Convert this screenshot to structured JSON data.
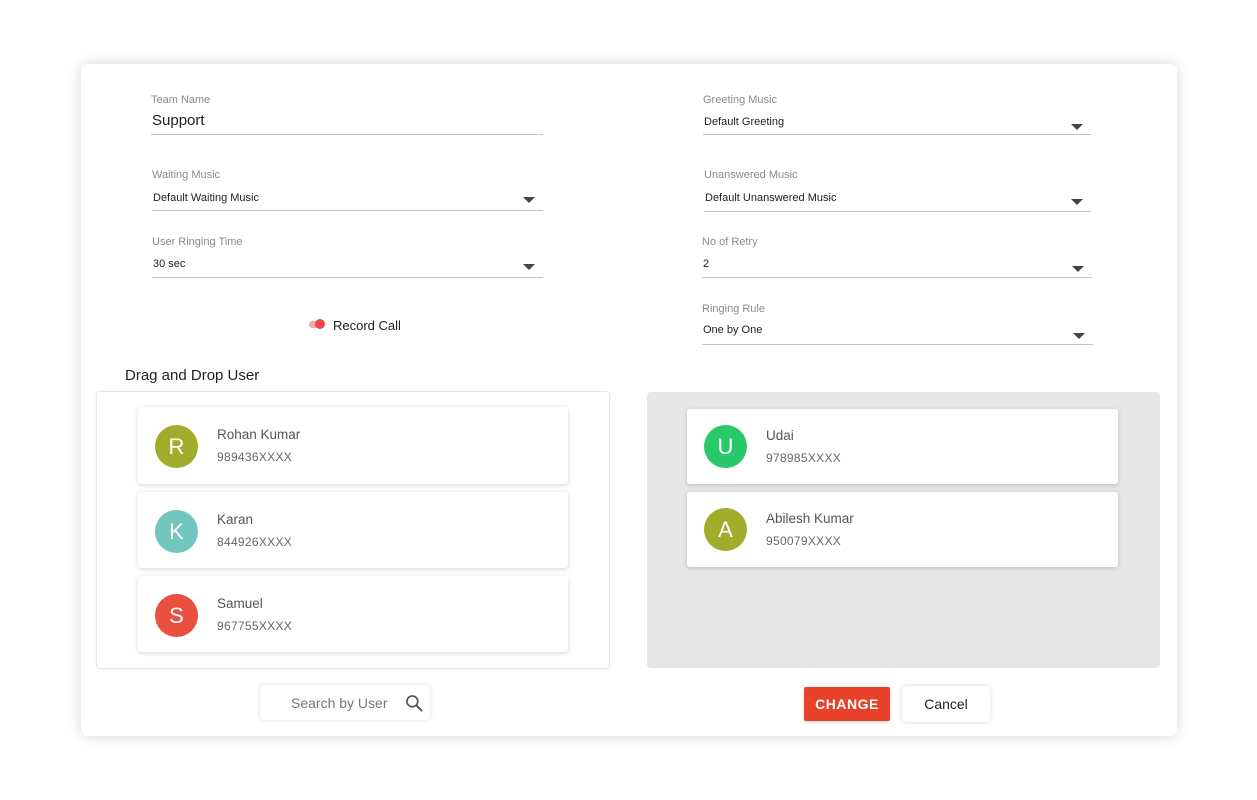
{
  "form": {
    "team_name": {
      "label": "Team Name",
      "value": "Support"
    },
    "greeting_music": {
      "label": "Greeting Music",
      "value": "Default Greeting"
    },
    "waiting_music": {
      "label": "Waiting Music",
      "value": "Default Waiting Music"
    },
    "unanswered_music": {
      "label": "Unanswered Music",
      "value": "Default Unanswered Music"
    },
    "user_ringing_time": {
      "label": "User Ringing Time",
      "value": "30 sec"
    },
    "no_of_retry": {
      "label": "No of Retry",
      "value": "2"
    },
    "ringing_rule": {
      "label": "Ringing Rule",
      "value": "One by One"
    },
    "record_call": {
      "label": "Record Call",
      "enabled": true
    }
  },
  "drag_drop": {
    "title": "Drag and Drop User",
    "available_users": [
      {
        "initial": "R",
        "name": "Rohan Kumar",
        "phone": "989436XXXX",
        "color": "#a0ad2b"
      },
      {
        "initial": "K",
        "name": "Karan",
        "phone": "844926XXXX",
        "color": "#73c6bd"
      },
      {
        "initial": "S",
        "name": "Samuel",
        "phone": "967755XXXX",
        "color": "#e9503f"
      }
    ],
    "assigned_users": [
      {
        "initial": "U",
        "name": "Udai",
        "phone": "978985XXXX",
        "color": "#29c86b"
      },
      {
        "initial": "A",
        "name": "Abilesh Kumar",
        "phone": "950079XXXX",
        "color": "#a0ad2b"
      }
    ]
  },
  "search": {
    "placeholder": "Search by User",
    "icon": "search-icon"
  },
  "actions": {
    "change_label": "CHANGE",
    "cancel_label": "Cancel"
  },
  "colors": {
    "accent": "#e8412b",
    "toggle": "#f04848",
    "drop_zone": "#e6e6e6"
  }
}
